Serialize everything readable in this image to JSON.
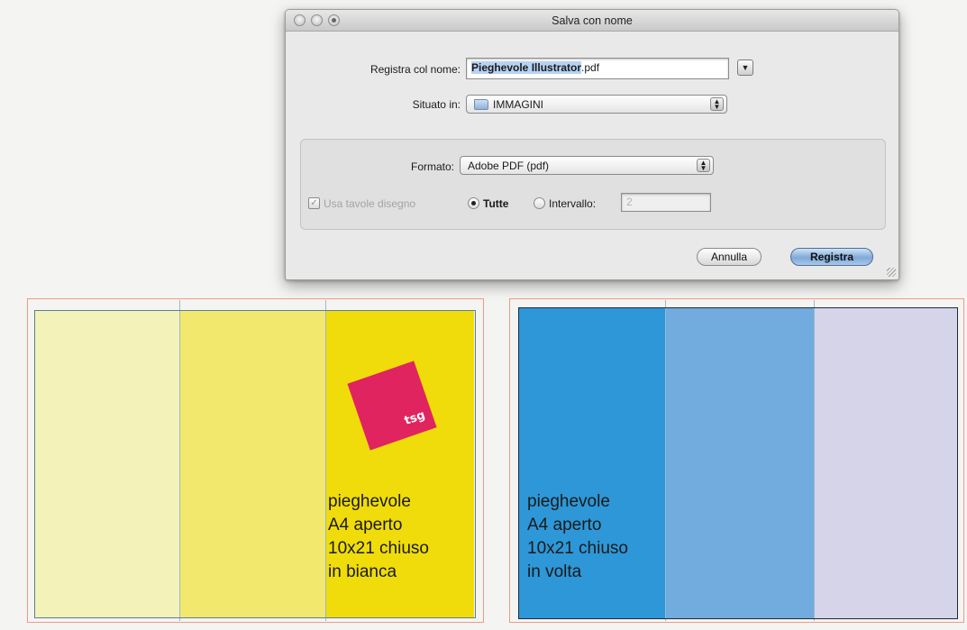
{
  "dialog": {
    "title": "Salva con nome",
    "save_as_label": "Registra col nome:",
    "file_name_selected": "Pieghevole Illustrator",
    "file_name_ext": ".pdf",
    "expand_icon": "chevron-down-icon",
    "where_label": "Situato in:",
    "where_value": "IMMAGINI",
    "format_label": "Formato:",
    "format_value": "Adobe PDF (pdf)",
    "use_artboards_label": "Usa tavole disegno",
    "use_artboards_checked": true,
    "all_label": "Tutte",
    "range_label": "Intervallo:",
    "range_value": "2",
    "cancel_label": "Annulla",
    "save_label": "Registra"
  },
  "artboard_front": {
    "panel_colors": [
      "#f3f2b8",
      "#f2e86e",
      "#f0dc0a"
    ],
    "logo_text": "tsg",
    "logo_color": "#e0245f",
    "caption": "pieghevole\nA4 aperto\n10x21 chiuso\nin bianca"
  },
  "artboard_back": {
    "panel_colors": [
      "#2e97d7",
      "#72abdd",
      "#d6d4e9"
    ],
    "caption": "pieghevole\nA4 aperto\n10x21 chiuso\nin volta"
  }
}
